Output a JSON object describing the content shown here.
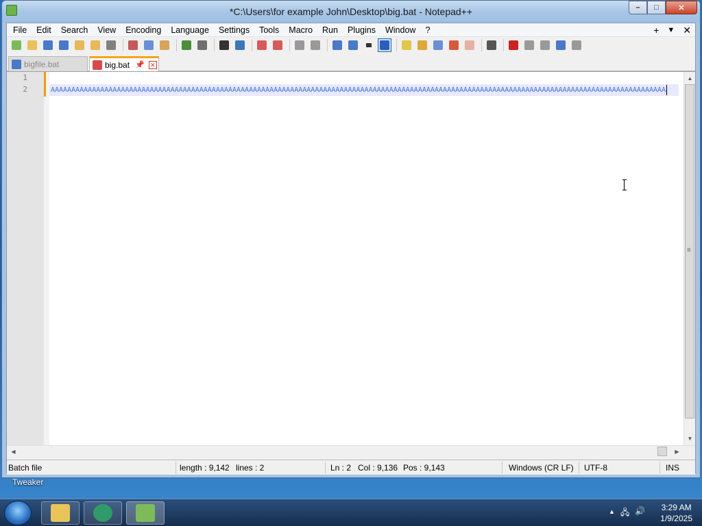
{
  "window": {
    "title": "*C:\\Users\\for example John\\Desktop\\big.bat - Notepad++",
    "controls": {
      "minimize": "–",
      "maximize": "□",
      "close": "✕"
    }
  },
  "menu": {
    "items": [
      "File",
      "Edit",
      "Search",
      "View",
      "Encoding",
      "Language",
      "Settings",
      "Tools",
      "Macro",
      "Run",
      "Plugins",
      "Window",
      "?"
    ],
    "right": {
      "add": "+",
      "dropdown": "▼",
      "close": "✕"
    }
  },
  "toolbar": {
    "icons": [
      {
        "name": "new-file-icon",
        "color": "#7dbb5a"
      },
      {
        "name": "open-file-icon",
        "color": "#e9c25a"
      },
      {
        "name": "save-icon",
        "color": "#4a79c9"
      },
      {
        "name": "save-all-icon",
        "color": "#4a79c9"
      },
      {
        "name": "close-icon",
        "color": "#e7b85a"
      },
      {
        "name": "close-all-icon",
        "color": "#e7b85a"
      },
      {
        "name": "print-icon",
        "color": "#808080"
      },
      {
        "name": "sep"
      },
      {
        "name": "cut-icon",
        "color": "#c35a5a"
      },
      {
        "name": "copy-icon",
        "color": "#6b8fd6"
      },
      {
        "name": "paste-icon",
        "color": "#d6a45a"
      },
      {
        "name": "sep"
      },
      {
        "name": "undo-icon",
        "color": "#4b8f3a"
      },
      {
        "name": "redo-icon",
        "color": "#6f6f6f"
      },
      {
        "name": "sep"
      },
      {
        "name": "find-icon",
        "color": "#333333"
      },
      {
        "name": "replace-icon",
        "color": "#3a77b5"
      },
      {
        "name": "sep"
      },
      {
        "name": "zoom-in-icon",
        "color": "#d65a5a"
      },
      {
        "name": "zoom-out-icon",
        "color": "#d65a5a"
      },
      {
        "name": "sep"
      },
      {
        "name": "sync-vertical-icon",
        "color": "#999999"
      },
      {
        "name": "sync-horizontal-icon",
        "color": "#999999"
      },
      {
        "name": "sep"
      },
      {
        "name": "word-wrap-icon",
        "color": "#4a79c9"
      },
      {
        "name": "show-all-chars-icon",
        "color": "#4a79c9"
      },
      {
        "name": "dropdown-icon",
        "color": "#333333"
      },
      {
        "name": "indent-guide-icon",
        "color": "#2b5fb5"
      },
      {
        "name": "sep"
      },
      {
        "name": "language-icon",
        "color": "#e0c64a"
      },
      {
        "name": "function-list-icon",
        "color": "#e0a83a"
      },
      {
        "name": "doc-map-icon",
        "color": "#6b8fd6"
      },
      {
        "name": "folder-workspace-icon",
        "color": "#d65a3a"
      },
      {
        "name": "document-list-icon",
        "color": "#e8b0a0"
      },
      {
        "name": "sep"
      },
      {
        "name": "monitor-icon",
        "color": "#555555"
      },
      {
        "name": "sep"
      },
      {
        "name": "record-macro-icon",
        "color": "#cc2222"
      },
      {
        "name": "stop-macro-icon",
        "color": "#999999"
      },
      {
        "name": "play-macro-icon",
        "color": "#999999"
      },
      {
        "name": "run-macro-multiple-icon",
        "color": "#4a79c9"
      },
      {
        "name": "save-macro-icon",
        "color": "#999999"
      }
    ]
  },
  "tabs": [
    {
      "label": "bigfile.bat",
      "active": false
    },
    {
      "label": "big.bat",
      "active": true,
      "pin": "📌",
      "close": "✕"
    }
  ],
  "editor": {
    "line_numbers": [
      "1",
      "2"
    ],
    "line2_text": "AAAAAAAAAAAAAAAAAAAAAAAAAAAAAAAAAAAAAAAAAAAAAAAAAAAAAAAAAAAAAAAAAAAAAAAAAAAAAAAAAAAAAAAAAAAAAAAAAAAAAAAAAAAAAAAAAAAAAAAAAAAAAAAAAAAAAAAAAAAAAAAAAAAAAAAAAAAAA"
  },
  "scroll": {
    "up": "▲",
    "down": "▼",
    "left": "◀",
    "right": "▶",
    "grip": "≡"
  },
  "status": {
    "type": "Batch file",
    "length": "length : 9,142",
    "lines": "lines : 2",
    "ln": "Ln : 2",
    "col": "Col : 9,136",
    "pos": "Pos : 9,143",
    "eol": "Windows (CR LF)",
    "encoding": "UTF-8",
    "mode": "INS"
  },
  "desktop": {
    "label": "Tweaker"
  },
  "taskbar": {
    "tasks": [
      {
        "name": "explorer-task",
        "color": "#e8c45a"
      },
      {
        "name": "edge-task",
        "color": "#2f9a6a"
      },
      {
        "name": "notepadpp-task",
        "color": "#7dbb5a"
      }
    ],
    "tray": {
      "arrow": "▲",
      "network": "🖧",
      "volume": "🔊"
    },
    "time": "3:29 AM",
    "date": "1/9/2025"
  }
}
